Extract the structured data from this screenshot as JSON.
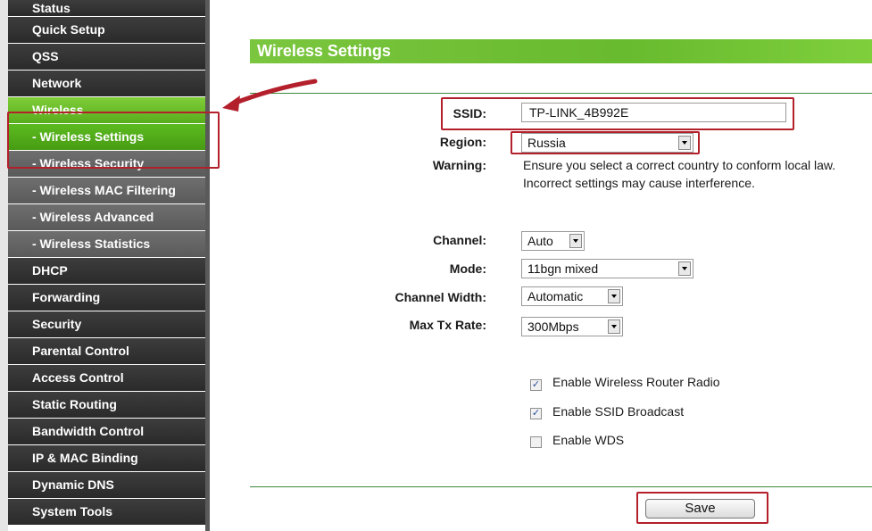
{
  "sidebar": {
    "items": [
      {
        "label": "Status",
        "kind": "main"
      },
      {
        "label": "Quick Setup",
        "kind": "main"
      },
      {
        "label": "QSS",
        "kind": "main"
      },
      {
        "label": "Network",
        "kind": "main"
      },
      {
        "label": "Wireless",
        "kind": "active"
      },
      {
        "label": "- Wireless Settings",
        "kind": "active-sub"
      },
      {
        "label": "- Wireless Security",
        "kind": "sub"
      },
      {
        "label": "- Wireless MAC Filtering",
        "kind": "sub"
      },
      {
        "label": "- Wireless Advanced",
        "kind": "sub"
      },
      {
        "label": "- Wireless Statistics",
        "kind": "sub"
      },
      {
        "label": "DHCP",
        "kind": "main"
      },
      {
        "label": "Forwarding",
        "kind": "main"
      },
      {
        "label": "Security",
        "kind": "main"
      },
      {
        "label": "Parental Control",
        "kind": "main"
      },
      {
        "label": "Access Control",
        "kind": "main"
      },
      {
        "label": "Static Routing",
        "kind": "main"
      },
      {
        "label": "Bandwidth Control",
        "kind": "main"
      },
      {
        "label": "IP & MAC Binding",
        "kind": "main"
      },
      {
        "label": "Dynamic DNS",
        "kind": "main"
      },
      {
        "label": "System Tools",
        "kind": "main"
      }
    ]
  },
  "header": {
    "title": "Wireless Settings"
  },
  "form": {
    "ssid": {
      "label": "SSID:",
      "value": "TP-LINK_4B992E"
    },
    "region": {
      "label": "Region:",
      "value": "Russia"
    },
    "warning": {
      "label": "Warning:",
      "line1": "Ensure you select a correct country to conform local law.",
      "line2": "Incorrect settings may cause interference."
    },
    "channel": {
      "label": "Channel:",
      "value": "Auto"
    },
    "mode": {
      "label": "Mode:",
      "value": "11bgn mixed"
    },
    "channel_width": {
      "label": "Channel Width:",
      "value": "Automatic"
    },
    "max_tx_rate": {
      "label": "Max Tx Rate:",
      "value": "300Mbps"
    },
    "checkboxes": [
      {
        "label": "Enable Wireless Router Radio",
        "checked": true
      },
      {
        "label": "Enable SSID Broadcast",
        "checked": true
      },
      {
        "label": "Enable WDS",
        "checked": false
      }
    ]
  },
  "actions": {
    "save_label": "Save"
  },
  "colors": {
    "accent_green": "#6cbf32",
    "annotation_red": "#b3202c",
    "sidebar_dark": "#333333"
  }
}
